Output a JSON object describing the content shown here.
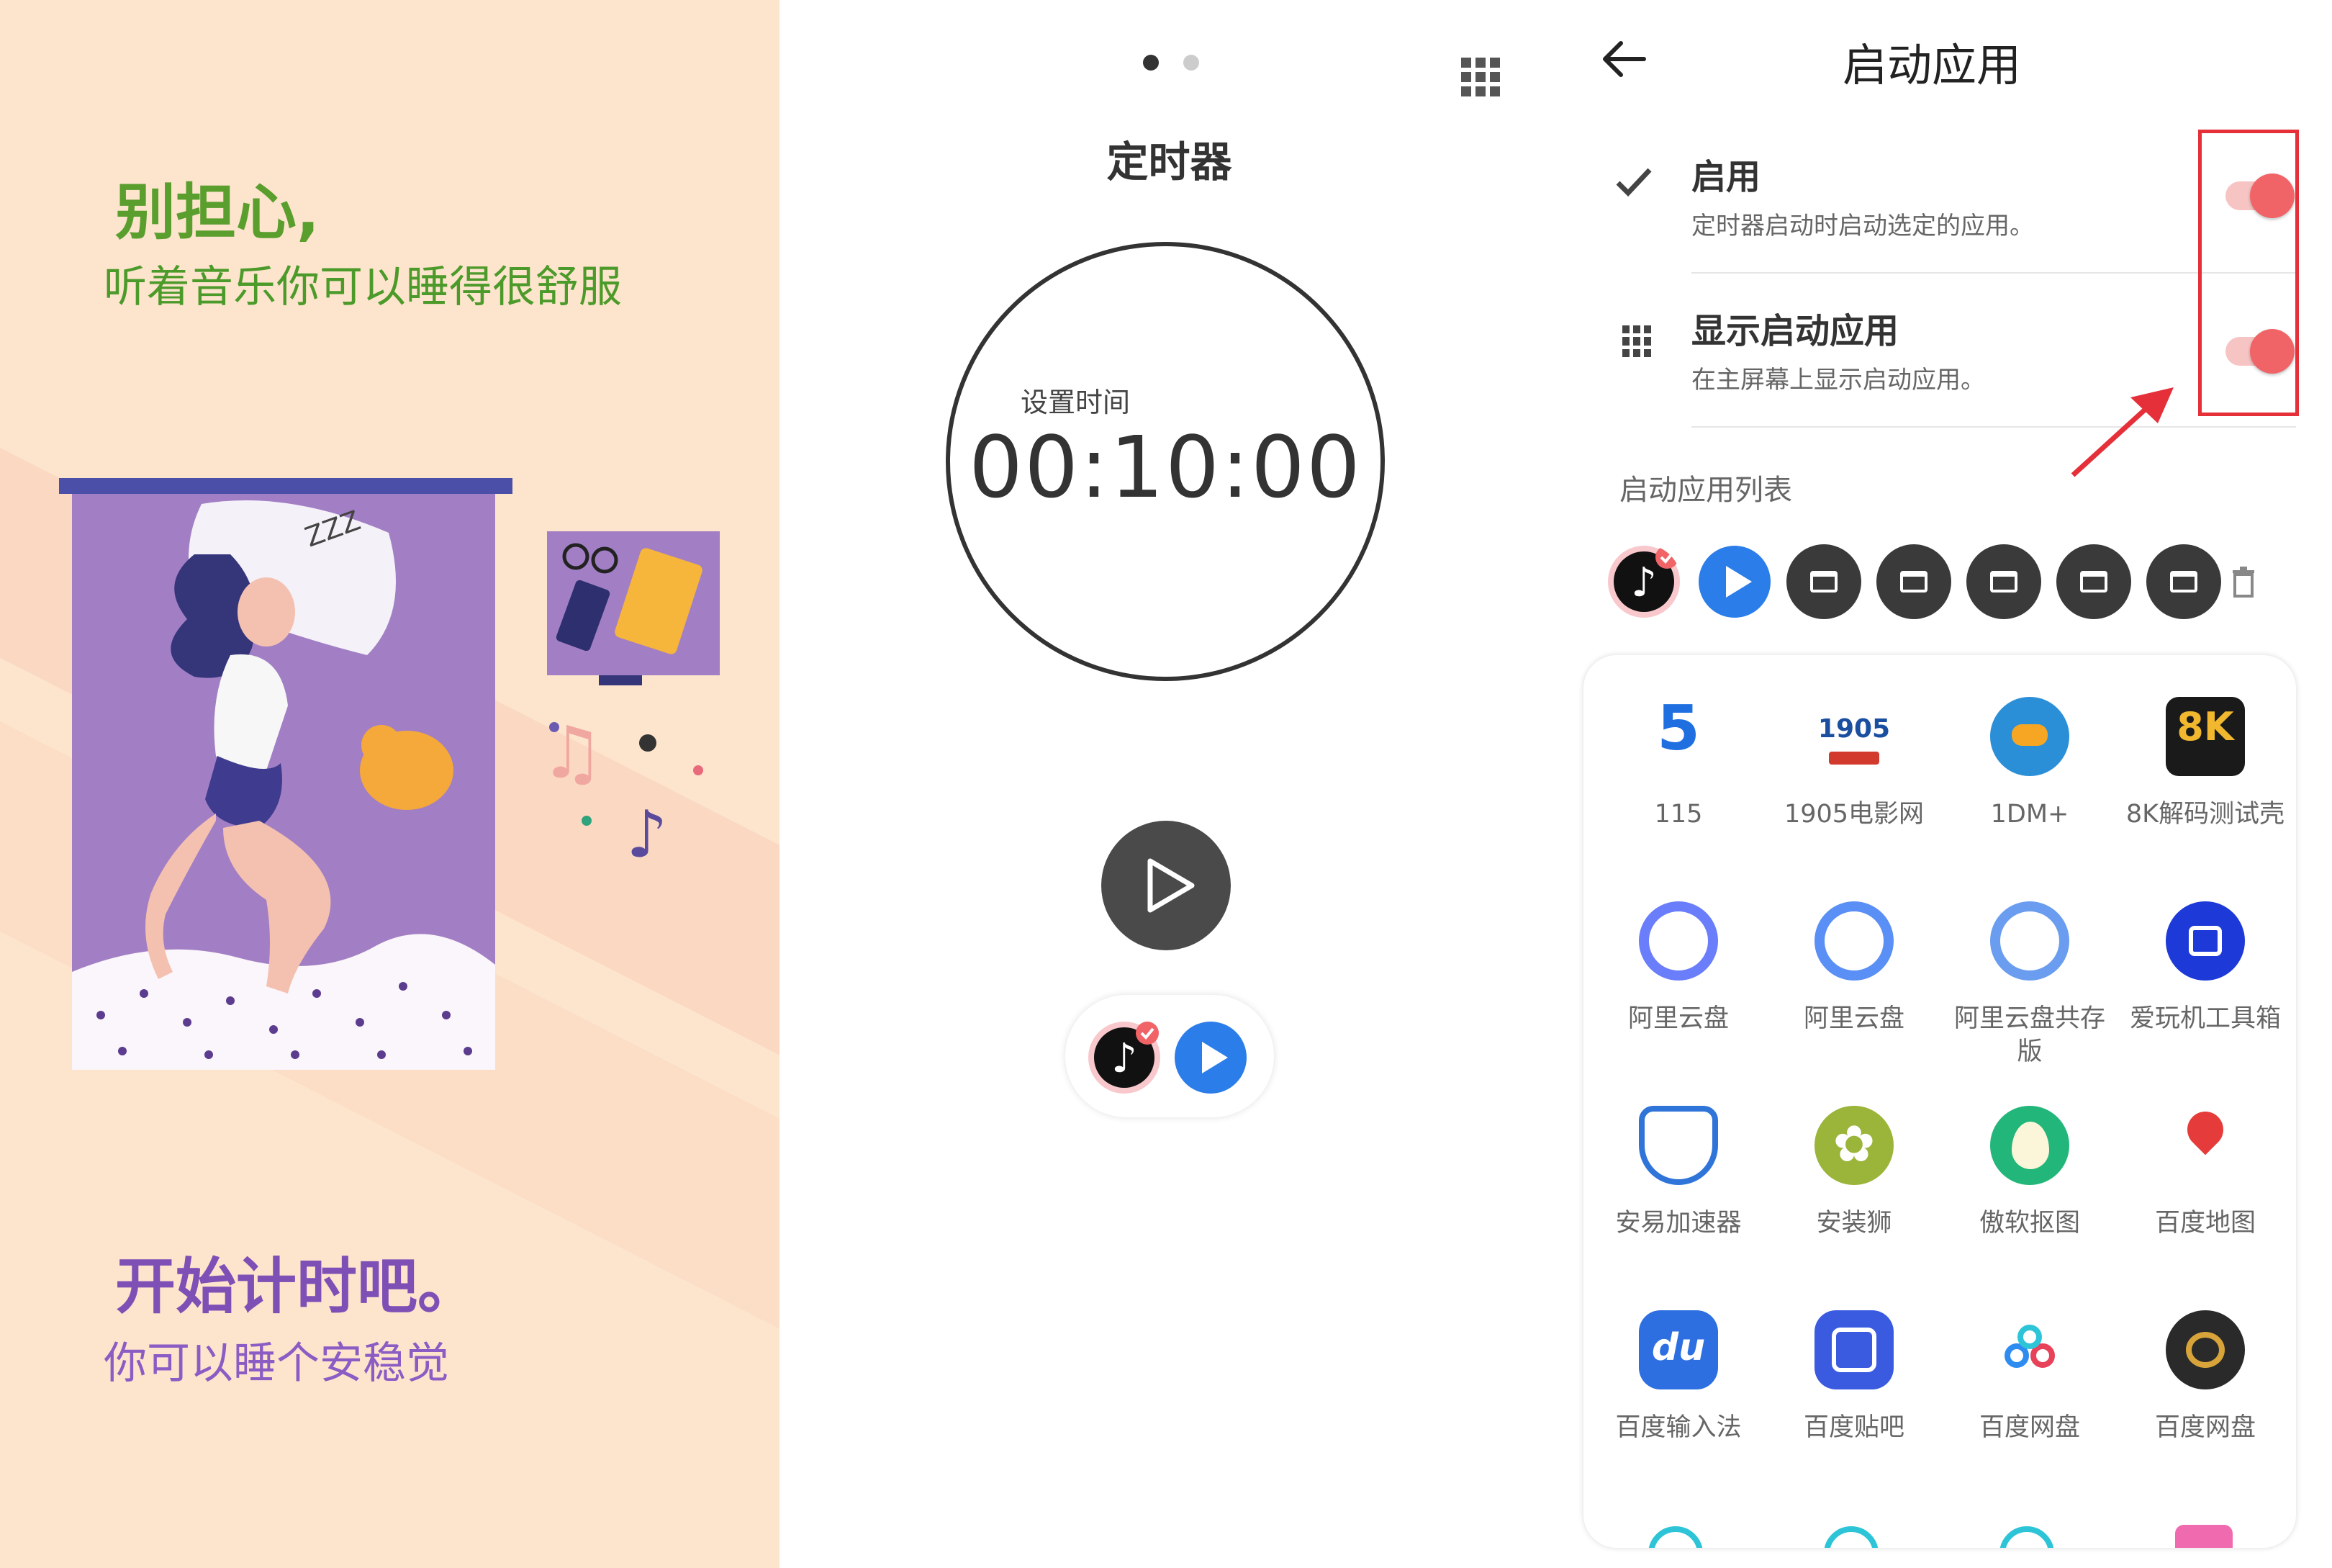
{
  "colors": {
    "splash_bg": "#fde5cd",
    "green_text": "#4c9a2a",
    "purple_text": "#7e4fb5",
    "toggle_on": "#f06467",
    "highlight_red": "#e5303a",
    "dark_button": "#4a4a4a"
  },
  "splash": {
    "headline_1": "别担心,",
    "subline_1": "听着音乐你可以睡得很舒服",
    "headline_2": "开始计时吧。",
    "subline_2": "你可以睡个安稳觉"
  },
  "timer": {
    "title": "定时器",
    "set_time_label": "设置时间",
    "time_value": "00:10:00",
    "page_indicator": {
      "count": 2,
      "active": 1
    },
    "pill_apps": [
      "tiktok-icon",
      "play-icon"
    ]
  },
  "launch": {
    "title": "启动应用",
    "enable": {
      "title": "启用",
      "subtitle": "定时器启动时启动选定的应用。",
      "on": true
    },
    "show": {
      "title": "显示启动应用",
      "subtitle": "在主屏幕上显示启动应用。",
      "on": true
    },
    "list_title": "启动应用列表",
    "selected_apps": [
      "tiktok-icon",
      "play-icon",
      "window-icon",
      "window-icon",
      "window-icon",
      "window-icon",
      "window-icon"
    ],
    "apps": [
      {
        "label": "115",
        "icon": "115-icon",
        "color": "#1f6fe0"
      },
      {
        "label": "1905电影网",
        "icon": "1905-icon",
        "color": "#d23a2e"
      },
      {
        "label": "1DM+",
        "icon": "download-icon",
        "color": "#2b8fd8"
      },
      {
        "label": "8K解码测试壳",
        "icon": "8k-icon",
        "color": "#1a1a1a"
      },
      {
        "label": "阿里云盘",
        "icon": "aliyun-icon",
        "color": "#6a7dfb"
      },
      {
        "label": "阿里云盘",
        "icon": "aliyun-icon",
        "color": "#5a8ff5"
      },
      {
        "label": "阿里云盘共存版",
        "icon": "aliyun-icon",
        "color": "#6a9cf0"
      },
      {
        "label": "爱玩机工具箱",
        "icon": "toolbox-icon",
        "color": "#1d3ad8"
      },
      {
        "label": "安易加速器",
        "icon": "shield-icon",
        "color": "#2f74d8"
      },
      {
        "label": "安装狮",
        "icon": "flower-icon",
        "color": "#9bb43a"
      },
      {
        "label": "傲软抠图",
        "icon": "leaf-icon",
        "color": "#22b67a"
      },
      {
        "label": "百度地图",
        "icon": "map-pin-icon",
        "color": "#e63b3b"
      },
      {
        "label": "百度输入法",
        "icon": "du-icon",
        "color": "#2d6fe0"
      },
      {
        "label": "百度贴吧",
        "icon": "tieba-icon",
        "color": "#3a5be0"
      },
      {
        "label": "百度网盘",
        "icon": "cloud-icon",
        "color": "#2e8cf0"
      },
      {
        "label": "百度网盘",
        "icon": "cloud-dark-icon",
        "color": "#2a2a2a"
      }
    ]
  }
}
